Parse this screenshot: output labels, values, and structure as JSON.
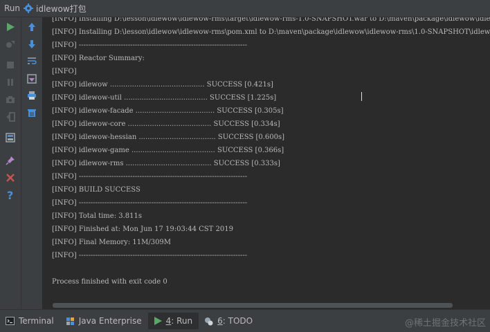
{
  "titlebar": {
    "tool_label": "Run",
    "config_name": "idlewow打包"
  },
  "toolbar_left": [
    {
      "name": "rerun-button",
      "icon": "play-icon"
    },
    {
      "name": "debug-button",
      "icon": "debug-icon"
    },
    {
      "name": "stop-button",
      "icon": "stop-icon"
    },
    {
      "name": "pause-button",
      "icon": "pause-icon"
    },
    {
      "name": "dump-threads-button",
      "icon": "camera-icon"
    },
    {
      "name": "exit-button",
      "icon": "exit-icon"
    },
    {
      "name": "layout-button",
      "icon": "layout-icon"
    },
    {
      "name": "pin-button",
      "icon": "pin-icon"
    },
    {
      "name": "close-button",
      "icon": "close-icon"
    },
    {
      "name": "help-button",
      "icon": "help-icon"
    }
  ],
  "toolbar_right": [
    {
      "name": "scroll-up-button",
      "icon": "arrow-up-icon"
    },
    {
      "name": "scroll-down-button",
      "icon": "arrow-down-icon"
    },
    {
      "name": "soft-wrap-button",
      "icon": "soft-wrap-icon"
    },
    {
      "name": "scroll-to-end-button",
      "icon": "scroll-end-icon"
    },
    {
      "name": "print-button",
      "icon": "printer-icon"
    },
    {
      "name": "clear-all-button",
      "icon": "trash-icon"
    }
  ],
  "console": {
    "lines": [
      "[INFO] Installing D:\\lesson\\idlewow\\idlewow-rms\\target\\idlewow-rms-1.0-SNAPSHOT.war to D:\\maven\\package\\idlewow\\idlewow-rms\\1.0",
      "[INFO] Installing D:\\lesson\\idlewow\\idlewow-rms\\pom.xml to D:\\maven\\package\\idlewow\\idlewow-rms\\1.0-SNAPSHOT\\idlewow-rms",
      "[INFO] ------------------------------------------------------------------------",
      "[INFO] Reactor Summary:",
      "[INFO]",
      "[INFO] idlewow ........................................... SUCCESS [0.421s]",
      "[INFO] idlewow-util ...................................... SUCCESS [1.225s]",
      "[INFO] idlewow-facade .................................... SUCCESS [0.305s]",
      "[INFO] idlewow-core ...................................... SUCCESS [0.334s]",
      "[INFO] idlewow-hessian ................................... SUCCESS [0.600s]",
      "[INFO] idlewow-game ...................................... SUCCESS [0.366s]",
      "[INFO] idlewow-rms ....................................... SUCCESS [0.333s]",
      "[INFO] ------------------------------------------------------------------------",
      "[INFO] BUILD SUCCESS",
      "[INFO] ------------------------------------------------------------------------",
      "[INFO] Total time: 3.811s",
      "[INFO] Finished at: Mon Jun 17 19:03:44 CST 2019",
      "[INFO] Final Memory: 11M/309M",
      "[INFO] ------------------------------------------------------------------------",
      "",
      "Process finished with exit code 0"
    ]
  },
  "bottom_tabs": [
    {
      "label": "Terminal",
      "icon": "terminal-icon",
      "num": "",
      "active": false
    },
    {
      "label": "Java Enterprise",
      "icon": "java-enterprise-icon",
      "num": "",
      "active": false
    },
    {
      "label": ": Run",
      "icon": "play-icon",
      "num": "4",
      "active": true
    },
    {
      "label": ": TODO",
      "icon": "todo-icon",
      "num": "6",
      "active": false
    }
  ],
  "watermark": "@稀土掘金技术社区"
}
